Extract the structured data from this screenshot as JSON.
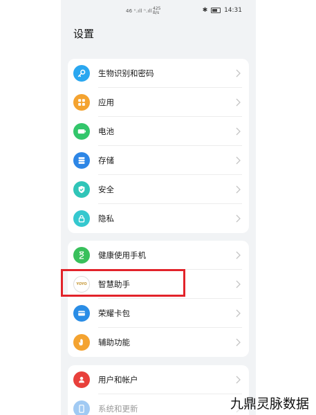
{
  "status_bar": {
    "signal_left": "46 ⁿ.ıll ⁿ.ıll",
    "net": "425\nB/s",
    "icons": "✱",
    "time": "14:31"
  },
  "page": {
    "title": "设置"
  },
  "groups": [
    [
      {
        "label": "生物识别和密码",
        "icon": "key-icon",
        "color": "#2aa7f0"
      },
      {
        "label": "应用",
        "icon": "apps-grid-icon",
        "color": "#f4a330"
      },
      {
        "label": "电池",
        "icon": "battery-icon",
        "color": "#33c66b"
      },
      {
        "label": "存储",
        "icon": "storage-icon",
        "color": "#2d86e6"
      },
      {
        "label": "安全",
        "icon": "shield-check-icon",
        "color": "#30c5b8"
      },
      {
        "label": "隐私",
        "icon": "lock-icon",
        "color": "#35c8cf"
      }
    ],
    [
      {
        "label": "健康使用手机",
        "icon": "hourglass-icon",
        "color": "#38c05b"
      },
      {
        "label": "智慧助手",
        "icon": "yoyo-assistant-icon",
        "color": "#ffffff"
      },
      {
        "label": "荣耀卡包",
        "icon": "wallet-icon",
        "color": "#2a8de6"
      },
      {
        "label": "辅助功能",
        "icon": "hand-icon",
        "color": "#f4a330"
      }
    ],
    [
      {
        "label": "用户和帐户",
        "icon": "user-icon",
        "color": "#e8403b"
      },
      {
        "label": "系统和更新",
        "icon": "system-update-icon",
        "color": "#2f8be5"
      }
    ]
  ],
  "assistant_logo_text": "YOYO",
  "watermark": "九鼎灵脉数据"
}
